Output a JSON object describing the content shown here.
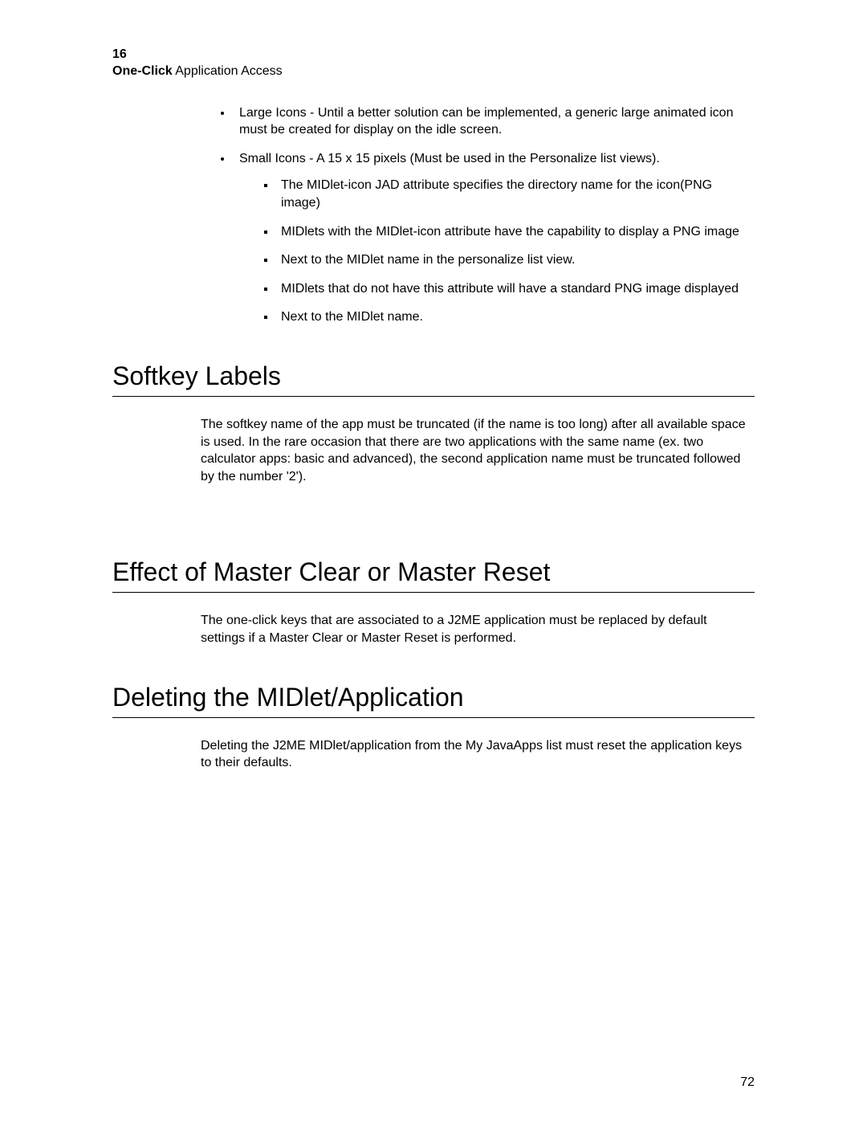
{
  "header": {
    "chapter_number": "16",
    "title_bold": "One-Click",
    "title_rest": " Application Access"
  },
  "top_bullets": [
    {
      "text": "Large Icons - Until a better solution can be implemented, a generic large animated icon must be created for display on the idle screen."
    },
    {
      "text": "Small Icons - A 15 x 15 pixels (Must be used in the Personalize list views).",
      "sub": [
        "The MIDlet-icon JAD attribute specifies the directory name for the icon(PNG image)",
        "MIDlets with the MIDlet-icon attribute have the capability to display a PNG image",
        "Next to the MIDlet name in the personalize list view.",
        "MIDlets that do not have this attribute will have a standard PNG image displayed",
        "Next to the MIDlet name."
      ]
    }
  ],
  "sections": [
    {
      "heading": "Softkey Labels",
      "paragraph": "The softkey name of the app must be truncated (if the name is too long) after all available space is used. In the rare occasion that there are two applications with the same name (ex. two calculator apps: basic and advanced), the second application name must be truncated followed by the number '2')."
    },
    {
      "heading": "Effect of Master Clear or Master Reset",
      "paragraph": "The one-click keys that are associated to a J2ME application must be replaced by default settings if a Master Clear or Master Reset is performed."
    },
    {
      "heading": "Deleting the MIDlet/Application",
      "paragraph": "Deleting the J2ME MIDlet/application from the My JavaApps list must reset the application keys to their defaults."
    }
  ],
  "page_number": "72"
}
